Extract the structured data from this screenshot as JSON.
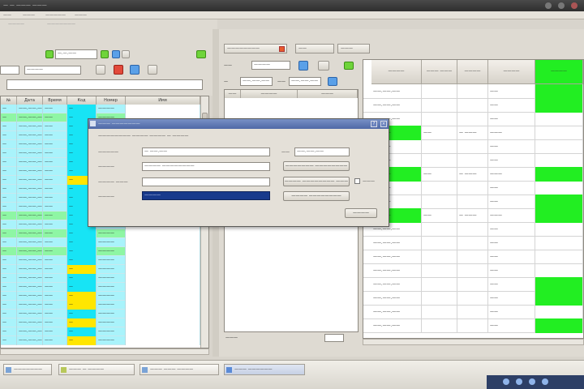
{
  "window": {
    "title": "— — ——— ———"
  },
  "menubar": {
    "items": [
      "——",
      "———",
      "—————",
      "———"
    ]
  },
  "subbar": {
    "items": [
      "————",
      "———————"
    ]
  },
  "left_toolbar": {
    "date_from": "—.—.——",
    "combo": "————",
    "search_value": ""
  },
  "left_grid": {
    "columns": [
      "№",
      "Дата",
      "Время",
      "Код",
      "Номер",
      "Имя"
    ],
    "rows": [
      {
        "c": [
          "—",
          "——.——.——",
          "——",
          "—",
          "————",
          ""
        ],
        "bg": "#a9f3fb",
        "code_bg": "#17e4f5"
      },
      {
        "c": [
          "—",
          "——.——.——",
          "——",
          "—",
          "————",
          ""
        ],
        "bg": "#8ef6a4",
        "code_bg": "#17e4f5"
      },
      {
        "c": [
          "—",
          "——.——.——",
          "——",
          "—",
          "————",
          ""
        ],
        "bg": "#a9f3fb",
        "code_bg": "#17e4f5"
      },
      {
        "c": [
          "—",
          "——.——.——",
          "——",
          "—",
          "————",
          ""
        ],
        "bg": "#a9f3fb",
        "code_bg": "#17e4f5"
      },
      {
        "c": [
          "—",
          "——.——.——",
          "——",
          "—",
          "————",
          ""
        ],
        "bg": "#a9f3fb",
        "code_bg": "#17e4f5"
      },
      {
        "c": [
          "—",
          "——.——.——",
          "——",
          "—",
          "————",
          ""
        ],
        "bg": "#a9f3fb",
        "code_bg": "#17e4f5"
      },
      {
        "c": [
          "—",
          "——.——.——",
          "——",
          "—",
          "————",
          ""
        ],
        "bg": "#a9f3fb",
        "code_bg": "#17e4f5"
      },
      {
        "c": [
          "—",
          "——.——.——",
          "——",
          "—",
          "————",
          ""
        ],
        "bg": "#a9f3fb",
        "code_bg": "#17e4f5"
      },
      {
        "c": [
          "—",
          "——.——.——",
          "——",
          "—",
          "————",
          ""
        ],
        "bg": "#a9f3fb",
        "code_bg": "#ffe600"
      },
      {
        "c": [
          "—",
          "——.——.——",
          "——",
          "—",
          "————",
          ""
        ],
        "bg": "#a9f3fb",
        "code_bg": "#17e4f5"
      },
      {
        "c": [
          "—",
          "——.——.——",
          "——",
          "—",
          "————",
          ""
        ],
        "bg": "#a9f3fb",
        "code_bg": "#17e4f5"
      },
      {
        "c": [
          "—",
          "——.——.——",
          "——",
          "—",
          "————",
          ""
        ],
        "bg": "#a9f3fb",
        "code_bg": "#17e4f5"
      },
      {
        "c": [
          "—",
          "——.——.——",
          "——",
          "—",
          "————",
          ""
        ],
        "bg": "#8ef6a4",
        "code_bg": "#17e4f5"
      },
      {
        "c": [
          "—",
          "——.——.——",
          "——",
          "—",
          "————",
          ""
        ],
        "bg": "#a9f3fb",
        "code_bg": "#17e4f5"
      },
      {
        "c": [
          "—",
          "——.——.——",
          "——",
          "—",
          "————",
          ""
        ],
        "bg": "#8ef6a4",
        "code_bg": "#17e4f5"
      },
      {
        "c": [
          "—",
          "——.——.——",
          "——",
          "—",
          "————",
          ""
        ],
        "bg": "#a9f3fb",
        "code_bg": "#17e4f5"
      },
      {
        "c": [
          "—",
          "——.——.——",
          "——",
          "—",
          "————",
          ""
        ],
        "bg": "#8ef6a4",
        "code_bg": "#17e4f5"
      },
      {
        "c": [
          "—",
          "——.——.——",
          "——",
          "—",
          "————",
          ""
        ],
        "bg": "#a9f3fb",
        "code_bg": "#17e4f5"
      },
      {
        "c": [
          "—",
          "——.——.——",
          "——",
          "—",
          "————",
          ""
        ],
        "bg": "#a9f3fb",
        "code_bg": "#ffe600"
      },
      {
        "c": [
          "—",
          "——.——.——",
          "——",
          "—",
          "————",
          ""
        ],
        "bg": "#a9f3fb",
        "code_bg": "#17e4f5"
      },
      {
        "c": [
          "—",
          "——.——.——",
          "——",
          "—",
          "————",
          ""
        ],
        "bg": "#a9f3fb",
        "code_bg": "#17e4f5"
      },
      {
        "c": [
          "—",
          "——.——.——",
          "——",
          "—",
          "————",
          ""
        ],
        "bg": "#a9f3fb",
        "code_bg": "#ffe600"
      },
      {
        "c": [
          "—",
          "——.——.——",
          "——",
          "—",
          "————",
          ""
        ],
        "bg": "#a9f3fb",
        "code_bg": "#ffe600"
      },
      {
        "c": [
          "—",
          "——.——.——",
          "——",
          "—",
          "————",
          ""
        ],
        "bg": "#a9f3fb",
        "code_bg": "#17e4f5"
      },
      {
        "c": [
          "—",
          "——.——.——",
          "——",
          "—",
          "————",
          ""
        ],
        "bg": "#a9f3fb",
        "code_bg": "#ffe600"
      },
      {
        "c": [
          "—",
          "——.——.——",
          "——",
          "—",
          "————",
          ""
        ],
        "bg": "#a9f3fb",
        "code_bg": "#17e4f5"
      },
      {
        "c": [
          "—",
          "——.——.——",
          "——",
          "—",
          "————",
          ""
        ],
        "bg": "#a9f3fb",
        "code_bg": "#ffe600"
      }
    ]
  },
  "right_panel": {
    "tabs": [
      "————————",
      "——",
      "———"
    ],
    "filter_label_1": "——",
    "filter_combo_1": "————",
    "filter_label_2": "—",
    "filter_date_1": "——.——.——",
    "filter_label_3": "——",
    "filter_date_2": "——.——.——",
    "mid_columns": [
      "——",
      "————",
      "———"
    ],
    "bottom_label": "———"
  },
  "right_grid": {
    "columns": [
      "————",
      "——— ———",
      "————",
      "————",
      "————"
    ],
    "rows": [
      {
        "c": [
          "——.——.——",
          "",
          "",
          "——",
          ""
        ],
        "g": [
          false,
          false,
          false,
          false,
          true
        ]
      },
      {
        "c": [
          "——.——.——",
          "",
          "",
          "——",
          ""
        ],
        "g": [
          false,
          false,
          false,
          false,
          true
        ]
      },
      {
        "c": [
          "——.——.——",
          "",
          "",
          "——",
          ""
        ],
        "g": [
          false,
          false,
          false,
          false,
          false
        ]
      },
      {
        "c": [
          "——.——",
          "——",
          "— ———",
          "———",
          ""
        ],
        "g": [
          true,
          false,
          false,
          false,
          false
        ]
      },
      {
        "c": [
          "——.——",
          "",
          "",
          "——",
          ""
        ],
        "g": [
          false,
          false,
          false,
          false,
          false
        ]
      },
      {
        "c": [
          "——.——",
          "",
          "",
          "——",
          ""
        ],
        "g": [
          false,
          false,
          false,
          false,
          false
        ]
      },
      {
        "c": [
          "——.——",
          "——",
          "— ———",
          "———",
          ""
        ],
        "g": [
          true,
          false,
          false,
          false,
          true
        ]
      },
      {
        "c": [
          "——.——",
          "",
          "",
          "——",
          ""
        ],
        "g": [
          false,
          false,
          false,
          false,
          false
        ]
      },
      {
        "c": [
          "——.——",
          "",
          "",
          "——",
          ""
        ],
        "g": [
          false,
          false,
          false,
          false,
          true
        ]
      },
      {
        "c": [
          "——.——",
          "——",
          "— ———",
          "———",
          ""
        ],
        "g": [
          true,
          false,
          false,
          false,
          true
        ]
      },
      {
        "c": [
          "——.——.——",
          "",
          "",
          "——",
          ""
        ],
        "g": [
          false,
          false,
          false,
          false,
          false
        ]
      },
      {
        "c": [
          "——.——.——",
          "",
          "",
          "——",
          ""
        ],
        "g": [
          false,
          false,
          false,
          false,
          false
        ]
      },
      {
        "c": [
          "——.——.——",
          "",
          "",
          "——",
          ""
        ],
        "g": [
          false,
          false,
          false,
          false,
          false
        ]
      },
      {
        "c": [
          "——.——.——",
          "",
          "",
          "——",
          ""
        ],
        "g": [
          false,
          false,
          false,
          false,
          false
        ]
      },
      {
        "c": [
          "——.——.——",
          "",
          "",
          "——",
          ""
        ],
        "g": [
          false,
          false,
          false,
          false,
          true
        ]
      },
      {
        "c": [
          "——.——.——",
          "",
          "",
          "——",
          ""
        ],
        "g": [
          false,
          false,
          false,
          false,
          true
        ]
      },
      {
        "c": [
          "——.——.——",
          "",
          "",
          "——",
          ""
        ],
        "g": [
          false,
          false,
          false,
          false,
          false
        ]
      },
      {
        "c": [
          "——.——.——",
          "",
          "",
          "——",
          ""
        ],
        "g": [
          false,
          false,
          false,
          false,
          true
        ]
      }
    ]
  },
  "dialog": {
    "title": "——— ———————",
    "header": "———————— ———— ———— — ————",
    "label_1": "—————",
    "value_1": "— ——.——",
    "label_2": "——",
    "value_date": "——.——.——",
    "label_3": "————",
    "value_3": "———— ————————",
    "label_4": "———— ———",
    "value_4": "",
    "label_5": "————",
    "value_5": "————",
    "btn_1": "——————— ————————",
    "btn_2": "———— ———————— ———",
    "btn_3": "———— ————————",
    "checkbox_label": "———",
    "ok_label": "————"
  },
  "taskbar": {
    "items": [
      "———————",
      "——— — ————",
      "——— ——— ————",
      "——— ——————"
    ]
  },
  "colors": {
    "row_cyan": "#a9f3fb",
    "row_green": "#8ef6a4",
    "code_yellow": "#ffe600",
    "code_cyan": "#17e4f5",
    "cell_green": "#22ee22",
    "selection_blue": "#183a8c"
  }
}
